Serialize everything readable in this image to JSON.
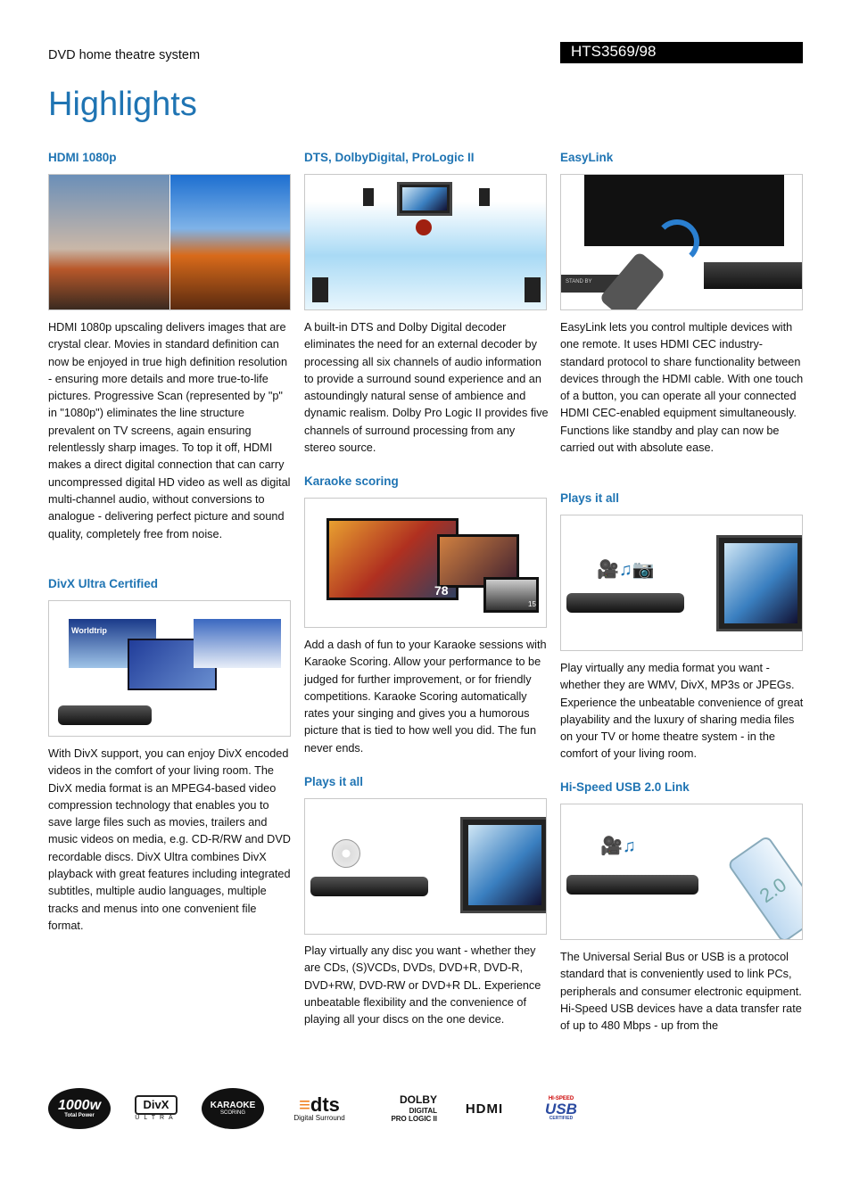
{
  "header": {
    "subtitle": "DVD home theatre system",
    "model": "HTS3569/98",
    "title": "Highlights"
  },
  "sections": [
    {
      "title": "HDMI 1080p",
      "text": "HDMI 1080p upscaling delivers images that are crystal clear. Movies in standard definition can now be enjoyed in true high definition resolution - ensuring more details and more true-to-life pictures. Progressive Scan (represented by \"p\" in \"1080p\") eliminates the line structure prevalent on TV screens, again ensuring relentlessly sharp images. To top it off, HDMI makes a direct digital connection that can carry uncompressed digital HD video as well as digital multi-channel audio, without conversions to analogue - delivering perfect picture and sound quality, completely free from noise."
    },
    {
      "title": "DivX Ultra Certified",
      "text": "With DivX support, you can enjoy DivX encoded videos in the comfort of your living room. The DivX media format is an MPEG4-based video compression technology that enables you to save large files such as movies, trailers and music videos on media, e.g. CD-R/RW and DVD recordable discs. DivX Ultra combines DivX playback with great features including integrated subtitles, multiple audio languages, multiple tracks and menus into one convenient file format.",
      "image_label": "Worldtrip"
    },
    {
      "title": "DTS, DolbyDigital, ProLogic II",
      "text": "A built-in DTS and Dolby Digital decoder eliminates the need for an external decoder by processing all six channels of audio information to provide a surround sound experience and an astoundingly natural sense of ambience and dynamic realism. Dolby Pro Logic II provides five channels of surround processing from any stereo source."
    },
    {
      "title": "Karaoke scoring",
      "text": "Add a dash of fun to your Karaoke sessions with Karaoke Scoring. Allow your performance to be judged for further improvement, or for friendly competitions. Karaoke Scoring automatically rates your singing and gives you a humorous picture that is tied to how well you did. The fun never ends.",
      "scores": [
        "78",
        "15"
      ]
    },
    {
      "title": "Plays it all",
      "text": "Play virtually any disc you want - whether they are CDs, (S)VCDs, DVDs, DVD+R, DVD-R, DVD+RW, DVD-RW or DVD+R DL. Experience unbeatable flexibility and the convenience of playing all your discs on the one device."
    },
    {
      "title": "EasyLink",
      "text": "EasyLink lets you control multiple devices with one remote. It uses HDMI CEC industry-standard protocol to share functionality between devices through the HDMI cable. With one touch of a button, you can operate all your connected HDMI CEC-enabled equipment simultaneously. Functions like standby and play can now be carried out with absolute ease.",
      "remote_label": "STAND BY"
    },
    {
      "title": "Plays it all",
      "text": "Play virtually any media format you want - whether they are WMV, DivX, MP3s or JPEGs. Experience the unbeatable convenience of great playability and the luxury of sharing media files on your TV or home theatre system - in the comfort of your living room."
    },
    {
      "title": "Hi-Speed USB 2.0 Link",
      "text": "The Universal Serial Bus or USB is a protocol standard that is conveniently used to link PCs, peripherals and consumer electronic equipment. Hi-Speed USB devices have a data transfer rate of up to 480 Mbps - up from the",
      "usb_label": "2.0"
    }
  ],
  "logos": [
    {
      "name": "1000w",
      "main": "1000w",
      "sub": "Total Power"
    },
    {
      "name": "divx",
      "main": "DivX",
      "sub": "ULTRA"
    },
    {
      "name": "karaoke",
      "main": "KARAOKE",
      "sub": "SCORING"
    },
    {
      "name": "dts",
      "main": "dts",
      "sub": "Digital Surround"
    },
    {
      "name": "dolby",
      "main": "DOLBY",
      "sub": "DIGITAL",
      "sub2": "PRO LOGIC II"
    },
    {
      "name": "hdmi",
      "main": "HDMI"
    },
    {
      "name": "usb",
      "main": "USB",
      "sub": "HI-SPEED",
      "sub2": "CERTIFIED"
    }
  ],
  "colors": {
    "accent": "#1f74b3",
    "header_bg": "#000000"
  }
}
